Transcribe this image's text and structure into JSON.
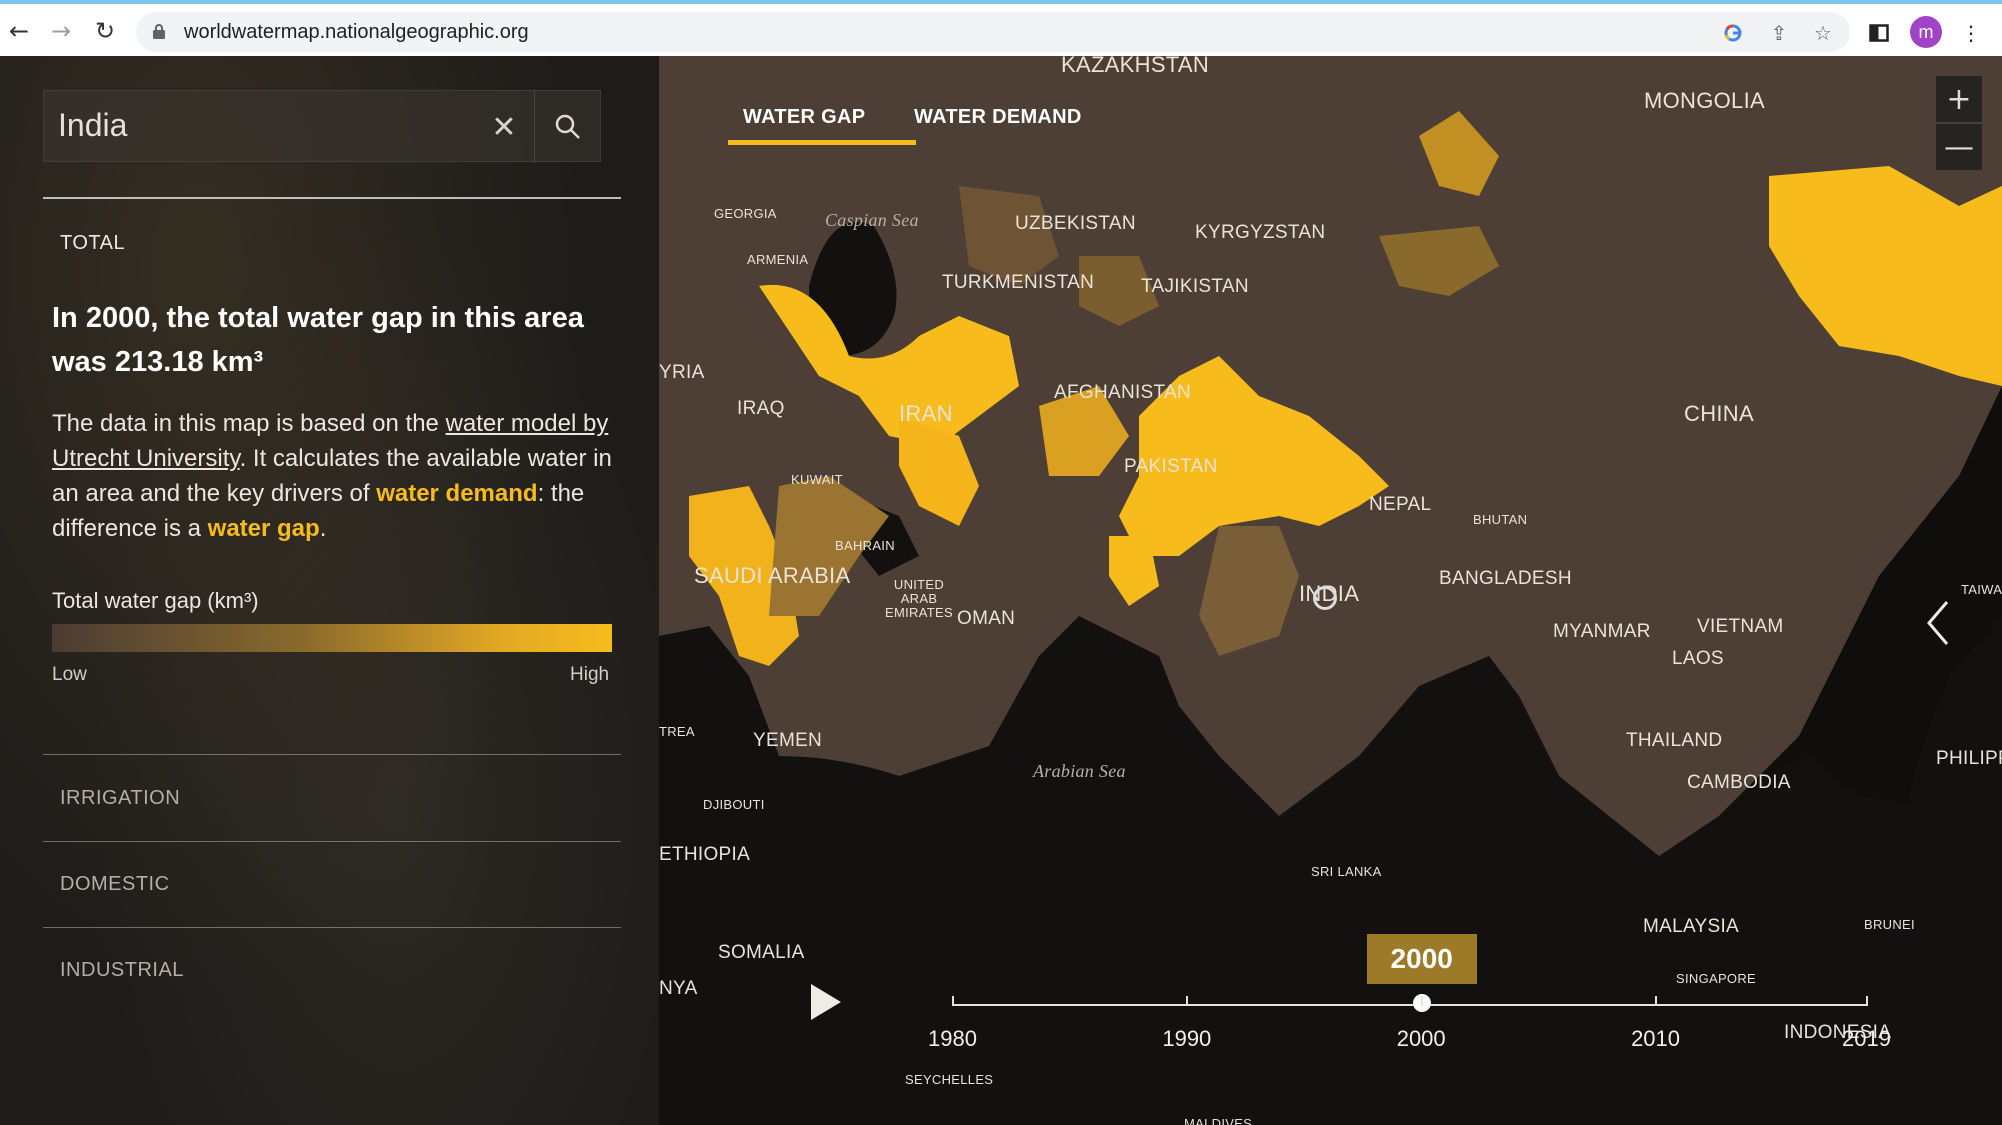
{
  "browser": {
    "url": "worldwatermap.nationalgeographic.org",
    "avatar_letter": "m",
    "icons": [
      "back-icon",
      "forward-icon",
      "reload-icon",
      "lock-icon",
      "google-icon",
      "share-icon",
      "star-icon",
      "sidepanel-icon",
      "more-icon"
    ]
  },
  "search": {
    "value": "India"
  },
  "panel": {
    "total_label": "TOTAL",
    "headline": "In 2000, the total water gap in this area was 213.18 km³",
    "body": {
      "part1": "The data in this map is based on the ",
      "link_model": "water model by Utrecht University",
      "part2": ". It calculates the available water in an area and the key drivers of ",
      "link_demand": "water demand",
      "part3": ": the difference is a ",
      "link_gap": "water gap",
      "part4": "."
    },
    "legend": {
      "title": "Total water gap (km³)",
      "low": "Low",
      "high": "High",
      "colors": [
        "#4a3c33",
        "#8a6a2c",
        "#e2a824",
        "#f7bc1c"
      ]
    },
    "sections": [
      "IRRIGATION",
      "DOMESTIC",
      "INDUSTRIAL"
    ]
  },
  "map": {
    "tabs": [
      "WATER GAP",
      "WATER DEMAND"
    ],
    "active_tab": "WATER GAP",
    "zoom_in": "+",
    "zoom_out": "—",
    "accent": "#f7bc1c",
    "labels": {
      "kazakhstan": "KAZAKHSTAN",
      "mongolia": "MONGOLIA",
      "georgia": "GEORGIA",
      "caspian": "Caspian Sea",
      "armenia": "ARMENIA",
      "uzbekistan": "UZBEKISTAN",
      "kyrgyzstan": "KYRGYZSTAN",
      "turkmenistan": "TURKMENISTAN",
      "tajikistan": "TAJIKISTAN",
      "syria": "YRIA",
      "iraq": "IRAQ",
      "iran": "IRAN",
      "afghanistan": "AFGHANISTAN",
      "china": "CHINA",
      "kuwait": "KUWAIT",
      "pakistan": "PAKISTAN",
      "nepal": "NEPAL",
      "bhutan": "BHUTAN",
      "bahrain": "BAHRAIN",
      "saudi": "SAUDI ARABIA",
      "uae": "UNITED ARAB EMIRATES",
      "oman": "OMAN",
      "india": "INDIA",
      "bangladesh": "BANGLADESH",
      "taiwan": "TAIWA",
      "myanmar": "MYANMAR",
      "vietnam": "VIETNAM",
      "laos": "LAOS",
      "eritrea": "TREA",
      "yemen": "YEMEN",
      "thailand": "THAILAND",
      "arabian_sea": "Arabian Sea",
      "philippines": "PHILIPPI",
      "cambodia": "CAMBODIA",
      "djibouti": "DJIBOUTI",
      "ethiopia": "ETHIOPIA",
      "sri_lanka": "SRI LANKA",
      "malaysia": "MALAYSIA",
      "brunei": "BRUNEI",
      "somalia": "SOMALIA",
      "kenya": "NYA",
      "singapore": "SINGAPORE",
      "indonesia": "INDONESIA",
      "seychelles": "SEYCHELLES",
      "maldives": "MALDIVES"
    }
  },
  "timeline": {
    "selected_year": "2000",
    "years": [
      "1980",
      "1990",
      "2000",
      "2010",
      "2019"
    ],
    "range": [
      1980,
      2019
    ],
    "selected_value": 2000
  }
}
